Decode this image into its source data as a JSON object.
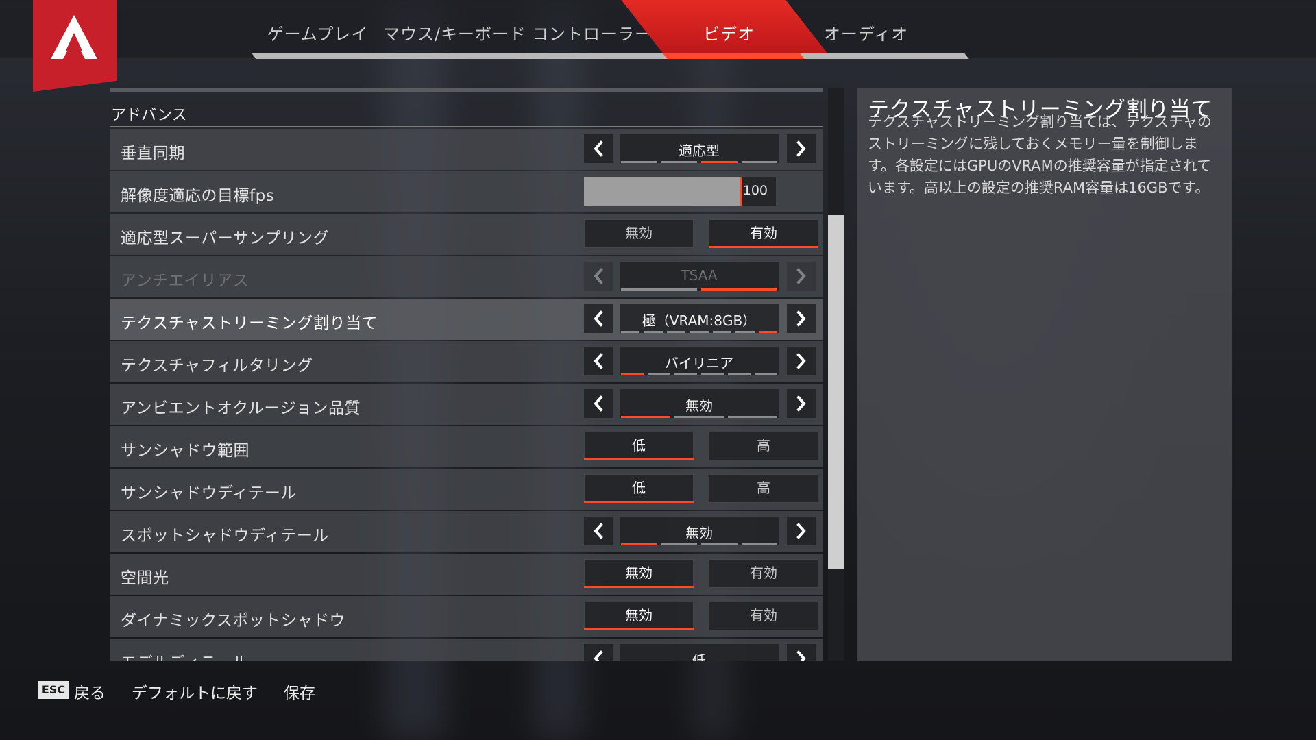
{
  "tabs": [
    {
      "label": "ゲームプレイ",
      "active": false
    },
    {
      "label": "マウス/キーボード",
      "active": false
    },
    {
      "label": "コントローラー",
      "active": false
    },
    {
      "label": "ビデオ",
      "active": true
    },
    {
      "label": "オーディオ",
      "active": false
    }
  ],
  "section_title": "アドバンス",
  "settings": [
    {
      "label": "垂直同期",
      "type": "cycle",
      "value": "適応型",
      "segments": 4,
      "selected": 3
    },
    {
      "label": "解像度適応の目標fps",
      "type": "slider",
      "value": "100",
      "fraction": 0.82
    },
    {
      "label": "適応型スーパーサンプリング",
      "type": "toggle",
      "options": [
        "無効",
        "有効"
      ],
      "selected": 1
    },
    {
      "label": "アンチエイリアス",
      "type": "cycle",
      "value": "TSAA",
      "segments": 2,
      "selected": 2,
      "disabled": true
    },
    {
      "label": "テクスチャストリーミング割り当て",
      "type": "cycle",
      "value": "極（VRAM:8GB）",
      "segments": 7,
      "selected": 7,
      "highlight": true
    },
    {
      "label": "テクスチャフィルタリング",
      "type": "cycle",
      "value": "バイリニア",
      "segments": 6,
      "selected": 1
    },
    {
      "label": "アンビエントオクルージョン品質",
      "type": "cycle",
      "value": "無効",
      "segments": 3,
      "selected": 1
    },
    {
      "label": "サンシャドウ範囲",
      "type": "toggle",
      "options": [
        "低",
        "高"
      ],
      "selected": 0
    },
    {
      "label": "サンシャドウディテール",
      "type": "toggle",
      "options": [
        "低",
        "高"
      ],
      "selected": 0
    },
    {
      "label": "スポットシャドウディテール",
      "type": "cycle",
      "value": "無効",
      "segments": 4,
      "selected": 1
    },
    {
      "label": "空間光",
      "type": "toggle",
      "options": [
        "無効",
        "有効"
      ],
      "selected": 0
    },
    {
      "label": "ダイナミックスポットシャドウ",
      "type": "toggle",
      "options": [
        "無効",
        "有効"
      ],
      "selected": 0
    },
    {
      "label": "モデルディテール",
      "type": "cycle",
      "value": "低",
      "segments": 3,
      "selected": 1
    }
  ],
  "description": {
    "title": "テクスチャストリーミング割り当て",
    "body": "テクスチャストリーミング割り当ては、テクスチャのストリーミングに残しておくメモリー量を制御します。各設定にはGPUのVRAMの推奨容量が指定されています。高以上の設定の推奨RAM容量は16GBです。"
  },
  "footer": {
    "esc_key": "ESC",
    "back": "戻る",
    "reset_default": "デフォルトに戻す",
    "save": "保存"
  },
  "colors": {
    "accent": "#ff4b2a",
    "brand": "#c8202a"
  },
  "icons": {
    "logo": "apex-logo-icon",
    "left": "chevron-left-icon",
    "right": "chevron-right-icon"
  }
}
